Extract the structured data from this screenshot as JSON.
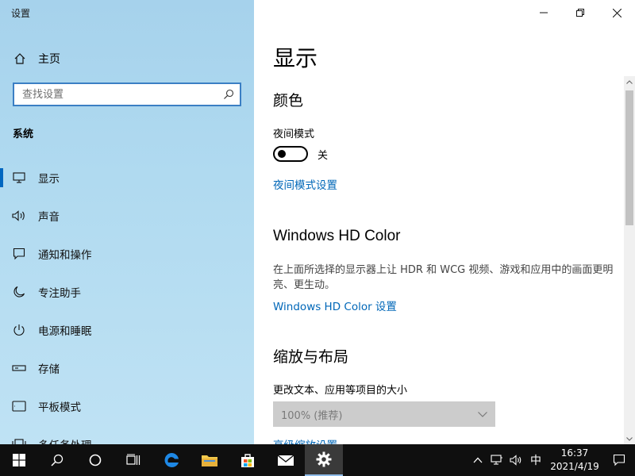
{
  "app": {
    "title": "设置"
  },
  "sidebar": {
    "home_label": "主页",
    "search_placeholder": "查找设置",
    "section_title": "系统",
    "items": [
      {
        "label": "显示",
        "icon": "monitor-icon",
        "active": true
      },
      {
        "label": "声音",
        "icon": "speaker-icon"
      },
      {
        "label": "通知和操作",
        "icon": "notification-icon"
      },
      {
        "label": "专注助手",
        "icon": "moon-icon"
      },
      {
        "label": "电源和睡眠",
        "icon": "power-icon"
      },
      {
        "label": "存储",
        "icon": "storage-icon"
      },
      {
        "label": "平板模式",
        "icon": "tablet-icon"
      },
      {
        "label": "多任务处理",
        "icon": "multitask-icon"
      }
    ]
  },
  "content": {
    "page_title": "显示",
    "color_heading": "颜色",
    "night_mode_label": "夜间模式",
    "night_mode_state": "关",
    "night_mode_link": "夜间模式设置",
    "hd_heading": "Windows HD Color",
    "hd_description": "在上面所选择的显示器上让 HDR 和 WCG 视频、游戏和应用中的画面更明亮、更生动。",
    "hd_link": "Windows HD Color 设置",
    "scale_heading": "缩放与布局",
    "scale_label": "更改文本、应用等项目的大小",
    "scale_value": "100% (推荐)",
    "advanced_link": "高级缩放设置"
  },
  "taskbar": {
    "ime": "中",
    "time": "16:37",
    "date": "2021/4/19"
  },
  "colors": {
    "accent": "#0067c0",
    "link": "#0067b8",
    "taskbar": "#0f0f0f"
  }
}
